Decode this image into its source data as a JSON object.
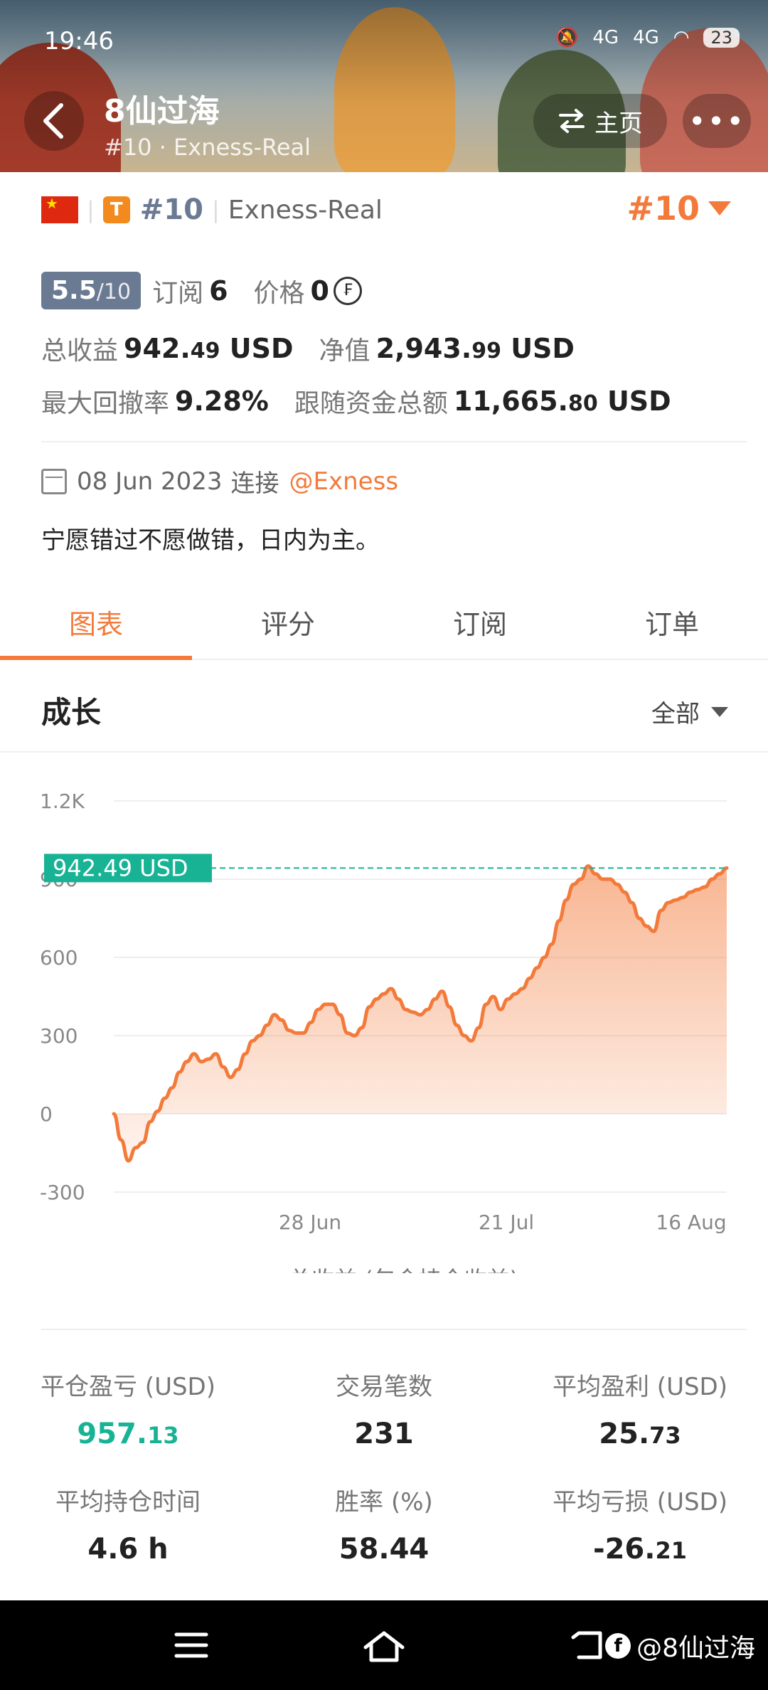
{
  "status_bar": {
    "time": "19:46",
    "network_1": "4G",
    "network_2": "4G",
    "battery": "23"
  },
  "header": {
    "title": "8仙过海",
    "subtitle": "#10 · Exness-Real",
    "home_label": "主页",
    "more_label": "•••"
  },
  "provider": {
    "rank": "#10",
    "type_badge": "T",
    "broker": "Exness-Real",
    "rank_right": "#10",
    "score_main": "5.5",
    "score_suffix": "/10",
    "subscribe_label": "订阅",
    "subscribe_value": "6",
    "price_label": "价格",
    "price_value": "0",
    "coin_symbol": "₣",
    "total_profit_label": "总收益",
    "total_profit_int": "942.",
    "total_profit_dec": "49",
    "total_profit_unit": "USD",
    "equity_label": "净值",
    "equity_int": "2,943.",
    "equity_dec": "99",
    "equity_unit": "USD",
    "drawdown_label": "最大回撤率",
    "drawdown_value": "9.28%",
    "follow_label": "跟随资金总额",
    "follow_int": "11,665.",
    "follow_dec": "80",
    "follow_unit": "USD",
    "date": "08 Jun 2023",
    "connect_label": "连接",
    "broker_link": "@Exness",
    "description": "宁愿错过不愿做错，日内为主。"
  },
  "tabs": [
    {
      "label": "图表",
      "active": true
    },
    {
      "label": "评分",
      "active": false
    },
    {
      "label": "订阅",
      "active": false
    },
    {
      "label": "订单",
      "active": false
    }
  ],
  "growth": {
    "title": "成长",
    "range": "全部"
  },
  "chart_data": {
    "type": "area",
    "y_ticks": [
      "1.2K",
      "900",
      "600",
      "300",
      "0",
      "-300"
    ],
    "ylim": [
      -300,
      1200
    ],
    "x_ticks": [
      "28 Jun",
      "21 Jul",
      "16 Aug"
    ],
    "current_label": "942.49 USD",
    "current_value": 942.49,
    "legend": "总收益 (包含持仓收益)",
    "series": [
      {
        "name": "总收益 (包含持仓收益)",
        "values": [
          0,
          -100,
          -180,
          -130,
          -110,
          -30,
          10,
          60,
          100,
          160,
          200,
          230,
          200,
          210,
          230,
          180,
          140,
          170,
          230,
          280,
          300,
          340,
          380,
          360,
          320,
          310,
          310,
          350,
          400,
          420,
          420,
          380,
          310,
          300,
          330,
          410,
          440,
          460,
          480,
          440,
          400,
          390,
          380,
          400,
          440,
          470,
          410,
          340,
          300,
          280,
          330,
          420,
          450,
          400,
          440,
          460,
          480,
          520,
          560,
          600,
          650,
          740,
          820,
          880,
          900,
          950,
          920,
          900,
          900,
          880,
          850,
          810,
          750,
          720,
          700,
          780,
          810,
          820,
          830,
          850,
          860,
          870,
          900,
          920,
          942.49
        ]
      }
    ]
  },
  "stats": [
    {
      "label": "平仓盈亏 (USD)",
      "int": "957.",
      "dec": "13",
      "green": true
    },
    {
      "label": "交易笔数",
      "int": "231",
      "dec": "",
      "green": false
    },
    {
      "label": "平均盈利 (USD)",
      "int": "25.",
      "dec": "73",
      "green": false
    },
    {
      "label": "平均持仓时间",
      "int": "4.6 h",
      "dec": "",
      "green": false
    },
    {
      "label": "胜率 (%)",
      "int": "58.44",
      "dec": "",
      "green": false
    },
    {
      "label": "平均亏损 (USD)",
      "int": "-26.",
      "dec": "21",
      "green": false
    }
  ],
  "nav": {
    "brand": "@8仙过海",
    "brand_icon": "f"
  },
  "colors": {
    "accent": "#f37a3a",
    "green": "#18b394",
    "badge": "#6b7a93"
  }
}
